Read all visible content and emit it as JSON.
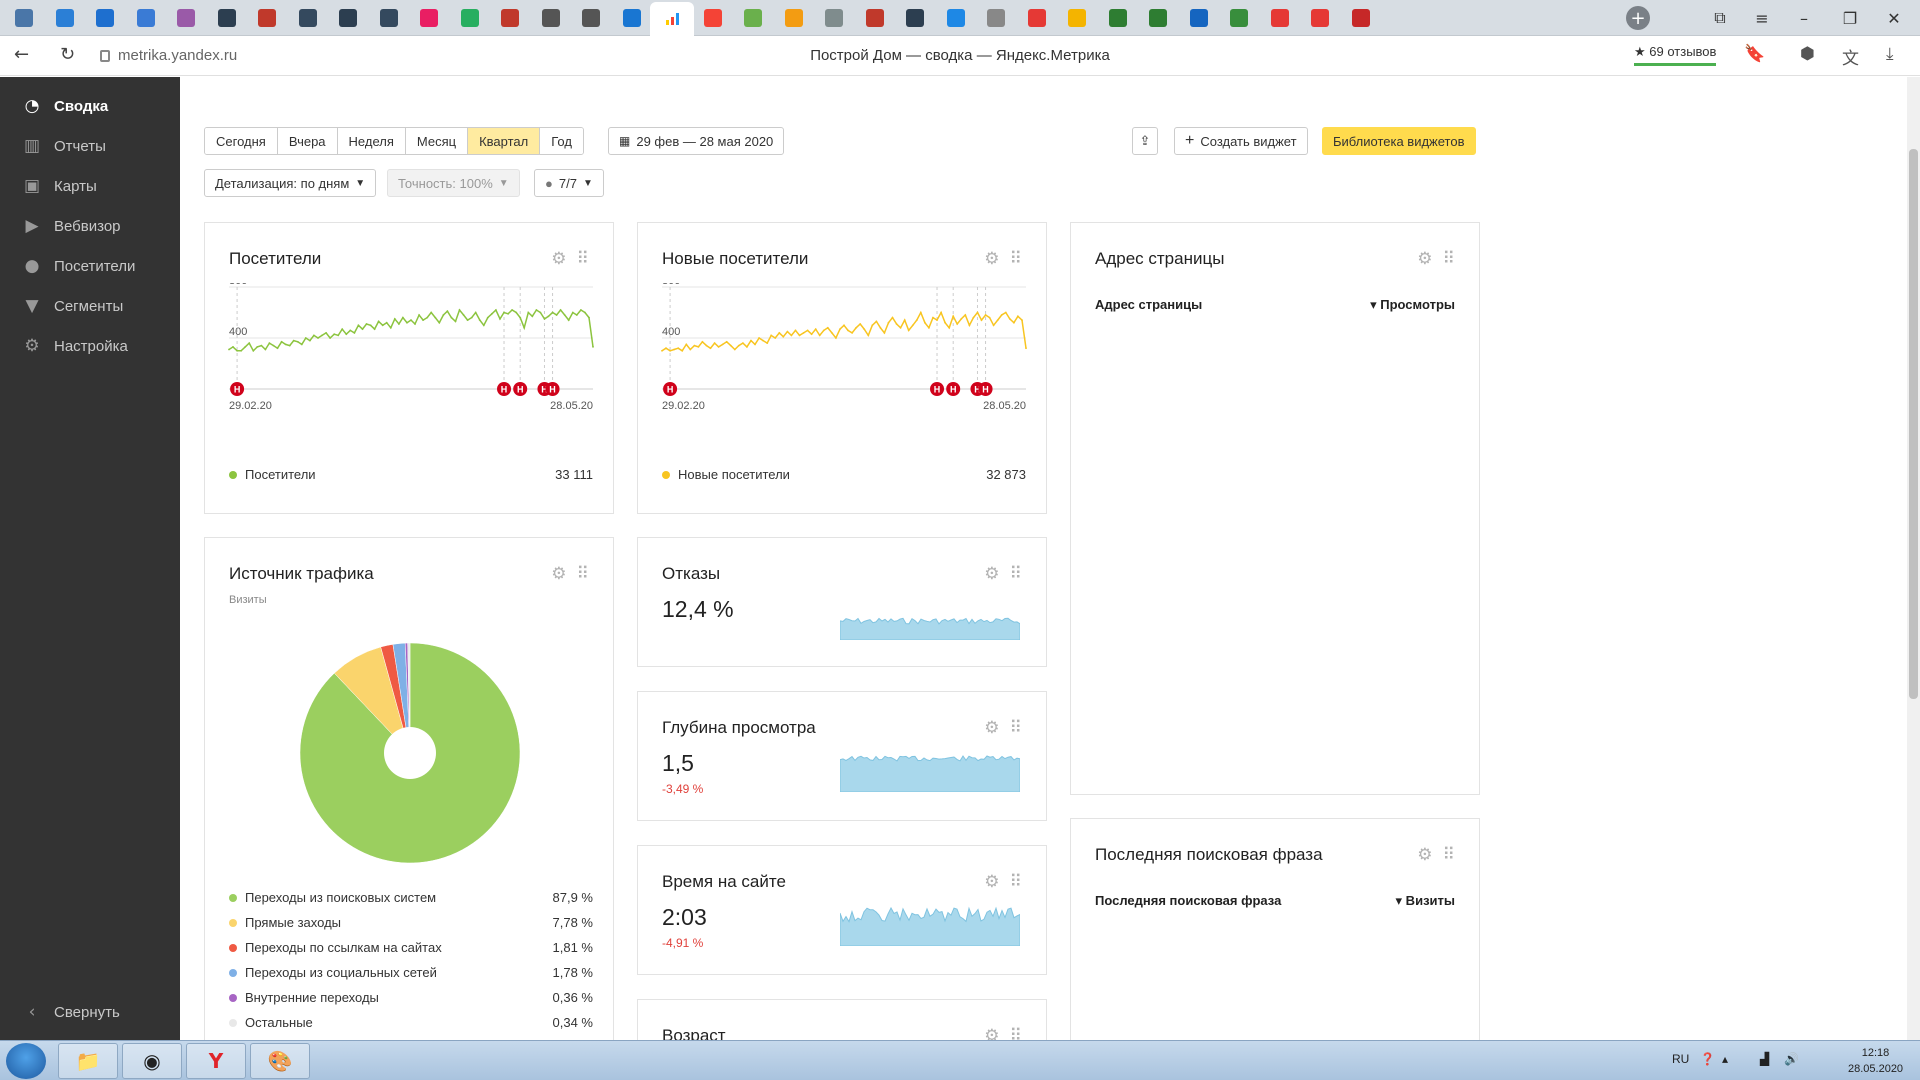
{
  "browser": {
    "url": "metrika.yandex.ru",
    "page_title": "Построй Дом — сводка — Яндекс.Метрика",
    "reviews": "★ 69 отзывов",
    "tab_icons": [
      "vk-icon",
      "video-icon",
      "m-icon",
      "chart-icon",
      "ring-icon",
      "screen-icon",
      "slash-icon",
      "chart-icon",
      "chart-icon",
      "chart-icon",
      "dot-icon",
      "green-icon",
      "red-icon",
      "apple-icon",
      "apple-icon",
      "monitor-icon",
      "metrika-icon",
      "yandex-icon",
      "ko-icon",
      "bolt-icon",
      "shield-icon",
      "red-icon",
      "check-icon",
      "globe-icon",
      "doc-icon",
      "youtube-icon",
      "mail-icon",
      "s-icon",
      "s-icon",
      "hand-icon",
      "android-icon",
      "youtube-icon",
      "youtube-icon",
      "house-icon"
    ]
  },
  "sidebar": {
    "items": [
      {
        "label": "Сводка",
        "icon": "dashboard-icon"
      },
      {
        "label": "Отчеты",
        "icon": "bar-chart-icon"
      },
      {
        "label": "Карты",
        "icon": "map-icon"
      },
      {
        "label": "Вебвизор",
        "icon": "play-icon"
      },
      {
        "label": "Посетители",
        "icon": "user-icon"
      },
      {
        "label": "Сегменты",
        "icon": "filter-icon"
      },
      {
        "label": "Настройка",
        "icon": "gear-icon"
      }
    ],
    "collapse": "Свернуть"
  },
  "toolbar": {
    "periods": [
      "Сегодня",
      "Вчера",
      "Неделя",
      "Месяц",
      "Квартал",
      "Год"
    ],
    "active_period": "Квартал",
    "date_range": "29 фев — 28 мая 2020",
    "create_widget": "Создать виджет",
    "widget_library": "Библиотека виджетов",
    "detail": "Детализация: по дням",
    "accuracy": "Точность: 100%",
    "segments": "7/7"
  },
  "widgets": {
    "visitors": {
      "title": "Посетители",
      "legend": "Посетители",
      "total": "33 111",
      "x_start": "29.02.20",
      "x_end": "28.05.20",
      "color": "#8cc43f"
    },
    "new_visitors": {
      "title": "Новые посетители",
      "legend": "Новые посетители",
      "total": "32 873",
      "x_start": "29.02.20",
      "x_end": "28.05.20",
      "color": "#f8c521"
    },
    "page_address": {
      "title": "Адрес страницы",
      "col1": "Адрес страницы",
      "col2": "▾ Просмотры"
    },
    "traffic": {
      "title": "Источник трафика",
      "subtitle": "Визиты",
      "items": [
        {
          "label": "Переходы из поисковых систем",
          "value": "87,9 %",
          "color": "#9bcf5f"
        },
        {
          "label": "Прямые заходы",
          "value": "7,78 %",
          "color": "#fad46c"
        },
        {
          "label": "Переходы по ссылкам на сайтах",
          "value": "1,81 %",
          "color": "#ef5a43"
        },
        {
          "label": "Переходы из социальных сетей",
          "value": "1,78 %",
          "color": "#7fb0e6"
        },
        {
          "label": "Внутренние переходы",
          "value": "0,36 %",
          "color": "#a765c4"
        },
        {
          "label": "Остальные",
          "value": "0,34 %",
          "color": "#e8e8e8"
        }
      ]
    },
    "bounce": {
      "title": "Отказы",
      "value": "12,4 %"
    },
    "depth": {
      "title": "Глубина просмотра",
      "value": "1,5",
      "delta": "-3,49 %"
    },
    "time": {
      "title": "Время на сайте",
      "value": "2:03",
      "delta": "-4,91 %"
    },
    "age": {
      "title": "Возраст"
    },
    "last_phrase": {
      "title": "Последняя поисковая фраза",
      "col1": "Последняя поисковая фраза",
      "col2": "▾ Визиты"
    }
  },
  "chart_data": [
    {
      "type": "line",
      "title": "Посетители",
      "series": [
        {
          "name": "Посетители",
          "values": [
            310,
            330,
            300,
            300,
            330,
            360,
            300,
            330,
            340,
            310,
            360,
            340,
            320,
            370,
            350,
            340,
            380,
            370,
            350,
            400,
            380,
            420,
            400,
            420,
            440,
            400,
            430,
            420,
            470,
            430,
            460,
            440,
            500,
            470,
            510,
            500,
            470,
            530,
            500,
            520,
            480,
            550,
            510,
            560,
            520,
            540,
            510,
            580,
            540,
            560,
            600,
            560,
            520,
            580,
            610,
            560,
            530,
            620,
            580,
            540,
            560,
            600,
            540,
            500,
            560,
            590,
            620,
            550,
            600,
            590,
            620,
            600,
            560,
            480,
            600,
            570,
            620,
            600,
            550,
            570,
            600,
            580,
            620,
            580,
            540,
            600,
            580,
            620,
            600,
            560,
            330
          ]
        }
      ],
      "ylim": [
        0,
        800
      ],
      "yticks": [
        400,
        800
      ],
      "x_labels": [
        "29.02.20",
        "28.05.20"
      ],
      "markers": [
        2,
        68,
        72,
        78,
        80
      ]
    },
    {
      "type": "line",
      "title": "Новые посетители",
      "series": [
        {
          "name": "Новые посетители",
          "values": [
            300,
            320,
            300,
            310,
            320,
            300,
            350,
            310,
            340,
            330,
            370,
            340,
            320,
            360,
            330,
            350,
            370,
            340,
            310,
            340,
            360,
            330,
            380,
            350,
            400,
            380,
            360,
            420,
            400,
            440,
            410,
            450,
            420,
            460,
            420,
            440,
            460,
            430,
            470,
            420,
            460,
            480,
            440,
            400,
            470,
            500,
            460,
            440,
            480,
            510,
            470,
            420,
            500,
            530,
            480,
            440,
            520,
            560,
            510,
            480,
            540,
            460,
            500,
            540,
            600,
            520,
            480,
            560,
            540,
            600,
            520,
            480,
            570,
            510,
            550,
            580,
            500,
            560,
            600,
            540,
            580,
            560,
            500,
            540,
            580,
            600,
            550,
            520,
            570,
            540,
            320
          ]
        }
      ],
      "ylim": [
        0,
        800
      ],
      "yticks": [
        400,
        800
      ],
      "x_labels": [
        "29.02.20",
        "28.05.20"
      ],
      "markers": [
        2,
        68,
        72,
        78,
        80
      ]
    },
    {
      "type": "pie",
      "title": "Источник трафика",
      "categories": [
        "Переходы из поисковых систем",
        "Прямые заходы",
        "Переходы по ссылкам на сайтах",
        "Переходы из социальных сетей",
        "Внутренние переходы",
        "Остальные"
      ],
      "values": [
        87.9,
        7.78,
        1.81,
        1.78,
        0.36,
        0.34
      ]
    }
  ]
}
